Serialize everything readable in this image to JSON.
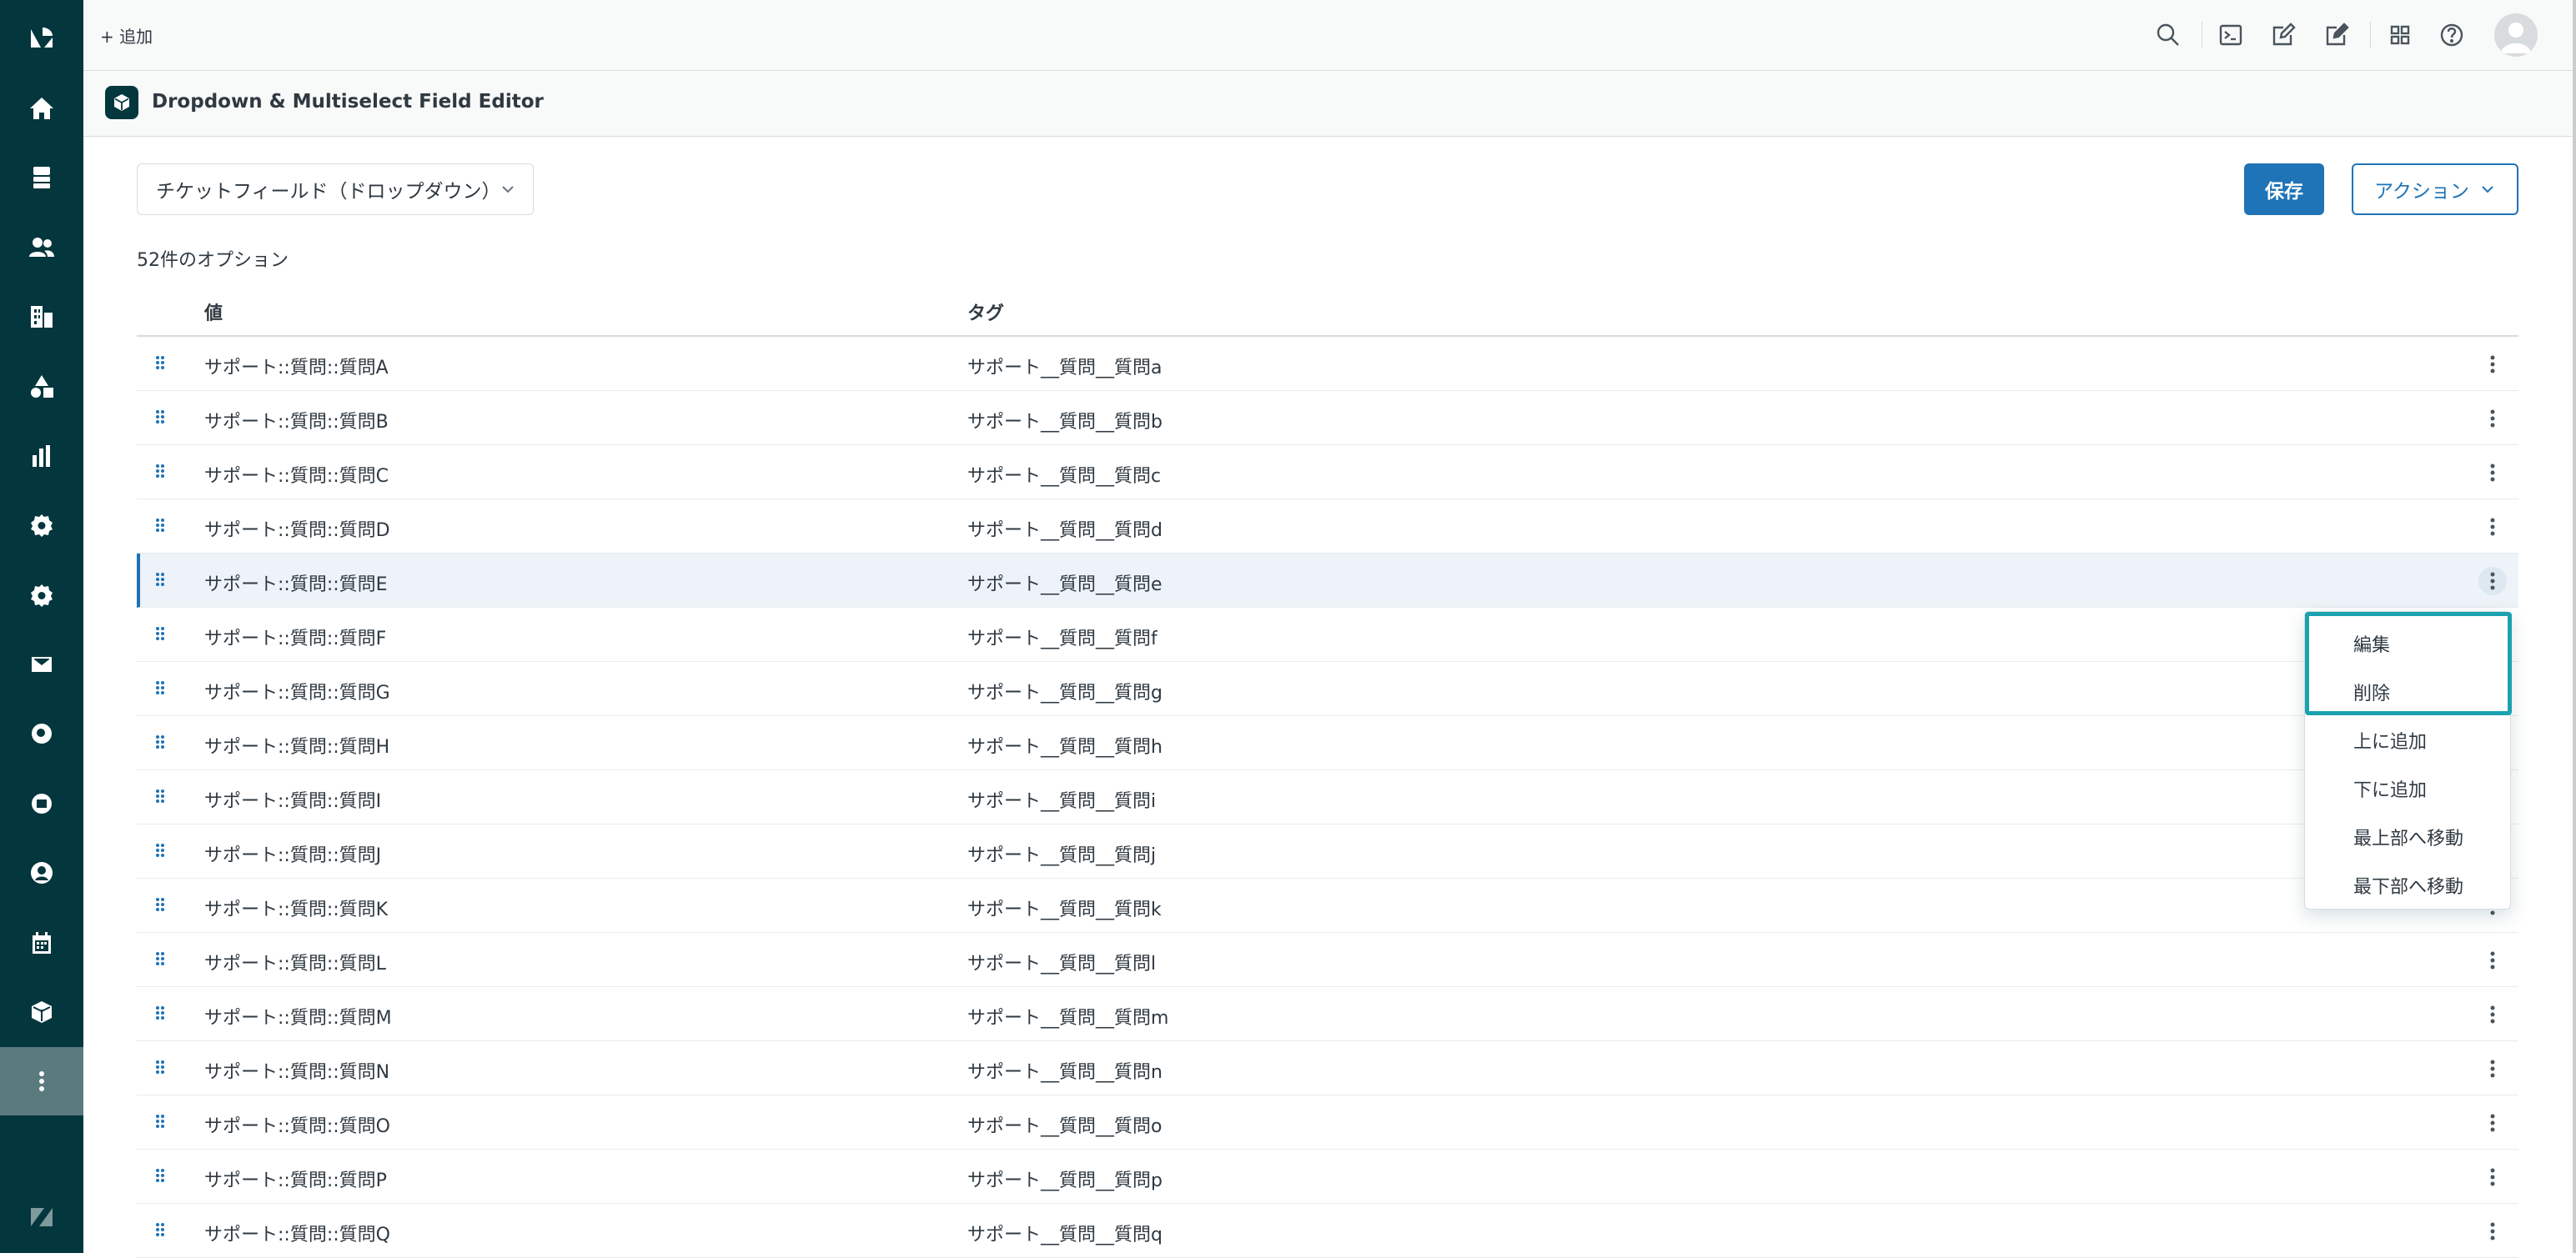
{
  "topbar": {
    "add_label": "+ 追加"
  },
  "app": {
    "title": "Dropdown & Multiselect Field Editor"
  },
  "controls": {
    "field_select_value": "チケットフィールド（ドロップダウン）",
    "save_label": "保存",
    "action_label": "アクション"
  },
  "option_count": "52件のオプション",
  "table": {
    "headers": {
      "value": "値",
      "tag": "タグ"
    },
    "rows": [
      {
        "value": "サポート::質問::質問A",
        "tag": "サポート__質問__質問a"
      },
      {
        "value": "サポート::質問::質問B",
        "tag": "サポート__質問__質問b"
      },
      {
        "value": "サポート::質問::質問C",
        "tag": "サポート__質問__質問c"
      },
      {
        "value": "サポート::質問::質問D",
        "tag": "サポート__質問__質問d"
      },
      {
        "value": "サポート::質問::質問E",
        "tag": "サポート__質問__質問e"
      },
      {
        "value": "サポート::質問::質問F",
        "tag": "サポート__質問__質問f"
      },
      {
        "value": "サポート::質問::質問G",
        "tag": "サポート__質問__質問g"
      },
      {
        "value": "サポート::質問::質問H",
        "tag": "サポート__質問__質問h"
      },
      {
        "value": "サポート::質問::質問I",
        "tag": "サポート__質問__質問i"
      },
      {
        "value": "サポート::質問::質問J",
        "tag": "サポート__質問__質問j"
      },
      {
        "value": "サポート::質問::質問K",
        "tag": "サポート__質問__質問k"
      },
      {
        "value": "サポート::質問::質問L",
        "tag": "サポート__質問__質問l"
      },
      {
        "value": "サポート::質問::質問M",
        "tag": "サポート__質問__質問m"
      },
      {
        "value": "サポート::質問::質問N",
        "tag": "サポート__質問__質問n"
      },
      {
        "value": "サポート::質問::質問O",
        "tag": "サポート__質問__質問o"
      },
      {
        "value": "サポート::質問::質問P",
        "tag": "サポート__質問__質問p"
      },
      {
        "value": "サポート::質問::質問Q",
        "tag": "サポート__質問__質問q"
      }
    ]
  },
  "context_menu": {
    "items": [
      "編集",
      "削除",
      "上に追加",
      "下に追加",
      "最上部へ移動",
      "最下部へ移動"
    ]
  },
  "colors": {
    "sidebar": "#03363d",
    "primary": "#1f73b7",
    "menu_highlight": "#1ba2b0",
    "selected_row": "#edf3f9"
  },
  "icons": {
    "sidebar": [
      "zendesk-logo-icon",
      "home-icon",
      "views-icon",
      "customers-icon",
      "organizations-icon",
      "objects-icon",
      "reporting-icon",
      "admin-icon",
      "settings-icon",
      "mail-icon",
      "search-app-icon",
      "app-icon",
      "user-icon",
      "calendar-icon",
      "apps-box-icon",
      "more-icon",
      "zendesk-z-icon"
    ],
    "topbar": [
      "search-icon",
      "terminal-icon",
      "edit-icon",
      "compose-icon",
      "grid-icon",
      "help-icon",
      "avatar-icon"
    ]
  }
}
